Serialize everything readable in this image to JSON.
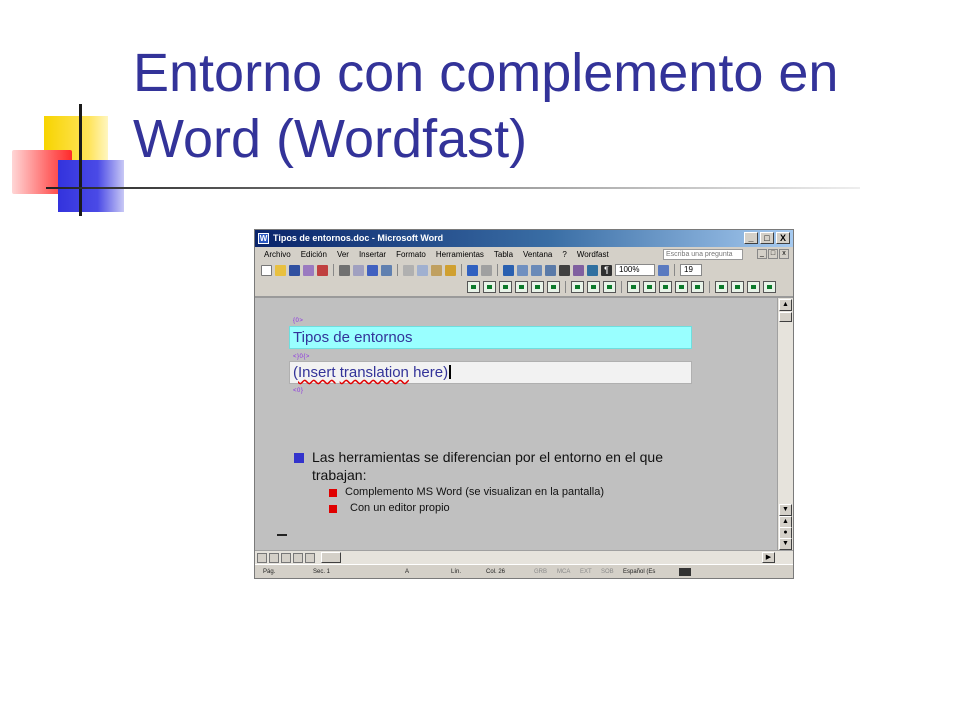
{
  "slide": {
    "title_line1": "Entorno con complemento en",
    "title_line2": "Word (Wordfast)"
  },
  "word": {
    "window_title": "Tipos de entornos.doc - Microsoft Word",
    "window_buttons": [
      "_",
      "□",
      "X"
    ],
    "menu": [
      "Archivo",
      "Edición",
      "Ver",
      "Insertar",
      "Formato",
      "Herramientas",
      "Tabla",
      "Ventana",
      "?",
      "Wordfast"
    ],
    "ask_placeholder": "Escriba una pregunta",
    "zoom": "100%",
    "font_size": "19",
    "tags": {
      "open_source": "{0>",
      "separator": "<}0{>",
      "close": "<0}"
    },
    "source_segment": "Tipos de entornos",
    "target_segment": {
      "open_paren": "(",
      "insert": "Insert",
      "translation": "translation",
      "here": "here",
      "close_paren": ")"
    },
    "bullets": {
      "main": "Las herramientas se diferencian por el entorno en el que trabajan:",
      "sub1": "Complemento MS Word (se visualizan en la pantalla)",
      "sub2": "Con un editor propio"
    },
    "status": {
      "page": "Pág.",
      "section": "Sec. 1",
      "of": "A",
      "line": "Lín.",
      "col": "Col. 26",
      "grb": "GRB",
      "mca": "MCA",
      "ext": "EXT",
      "sob": "SOB",
      "language": "Español (Es"
    }
  },
  "colors": {
    "title": "#333399",
    "source_highlight": "#99ffff",
    "bullet_main": "#3333cc",
    "bullet_sub": "#e00000",
    "titlebar_start": "#0a246a"
  }
}
